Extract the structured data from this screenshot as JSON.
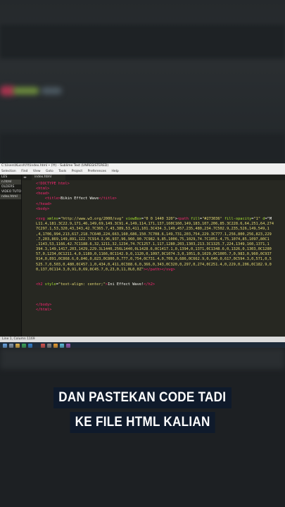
{
  "window": {
    "title": "C:\\Users\\Kucsh\\Yt\\index.html • (Yt) - Sublime Text (UNREGISTERED)",
    "menu": [
      "Selection",
      "Find",
      "View",
      "Goto",
      "Tools",
      "Project",
      "Preferences",
      "Help"
    ],
    "sidebar_items": [
      "LES",
      "n.html",
      "OLDERS",
      "VIDEO TUTORI",
      "ndex.html"
    ],
    "tab_label": "index.html",
    "status": "Line 1, Column 1169"
  },
  "code_lines": [
    {
      "parts": [
        [
          "t",
          "<!DOCTYPE html>"
        ]
      ]
    },
    {
      "parts": [
        [
          "t",
          "<html>"
        ]
      ]
    },
    {
      "parts": [
        [
          "t",
          "<head>"
        ]
      ]
    },
    {
      "parts": [
        [
          "d",
          "    "
        ],
        [
          "t",
          "<title>"
        ],
        [
          "d",
          "Bikin Effect Wave"
        ],
        [
          "t",
          "</title>"
        ]
      ]
    },
    {
      "parts": [
        [
          "t",
          "</head>"
        ]
      ]
    },
    {
      "parts": [
        [
          "t",
          "<body>"
        ]
      ]
    },
    {
      "parts": [
        [
          "d",
          ""
        ]
      ]
    },
    {
      "parts": [
        [
          "t",
          "<svg "
        ],
        [
          "a",
          "xmlns"
        ],
        [
          "d",
          "="
        ],
        [
          "s",
          "\"http://www.w3.org/2000/svg\""
        ],
        [
          "a",
          " viewBox"
        ],
        [
          "d",
          "="
        ],
        [
          "s",
          "\"0 0 1440 320\""
        ],
        [
          "d",
          ">"
        ],
        [
          "t",
          "<path "
        ],
        [
          "a",
          "fill"
        ],
        [
          "d",
          "="
        ],
        [
          "s",
          "\"#273036\""
        ],
        [
          "a",
          " fill-opacity"
        ],
        [
          "d",
          "="
        ],
        [
          "s",
          "\"1\""
        ],
        [
          "a",
          " d"
        ],
        [
          "d",
          "=\"M"
        ]
      ]
    },
    {
      "parts": [
        [
          "s",
          "L11.4,181.3C22.9,171,46,149,69,149.3C91.4,149,114,171,137,160C160,149,183,107,206,85.3C228.6,64,251,64,274"
        ]
      ]
    },
    {
      "parts": [
        [
          "s",
          "7C297.1,53,320,43,343,42.7C365.7,43,389,53,411,101.3C434.3,149,457,235,480,234.7C502.9,235,526,149,549,1"
        ]
      ]
    },
    {
      "parts": [
        [
          "s",
          ",4,1706,994,213,617,218.7C640,224,663,160,686,150.7C708.6,149,731,203,754,229.3C777.1,256,800,256,823,229"
        ]
      ]
    },
    {
      "parts": [
        [
          "s",
          ".7,203,869,149,891,122.7C914.3,96,937,96,960,90.7C982.9,85,1006,75,1029,74.7C1051.4,75,1074,85,1097,80C1"
        ]
      ]
    },
    {
      "parts": [
        [
          "s",
          ",1143,53,1166,42.7C1188.6,32,1211,32,1234,74.7C1257.1,117,1280,203,1303,213.3C1325.7,224,1349,160,1371,1"
        ]
      ]
    },
    {
      "parts": [
        [
          "s",
          "394.3,149,1417,203,1429,229.3L1440,256L1440,0L1428.6,0C1417.1,0,1394,0,1371,0C1348.6,0,1326,0,1303,0C1280"
        ]
      ]
    },
    {
      "parts": [
        [
          "s",
          "57,0,1234,0C1211.4,0,1189,0,1166,0C1142.9,0,1120,0,1097,0C1074.3,0,1051,0,1029,0C1005.7,0,983,0,960,0C937"
        ]
      ]
    },
    {
      "parts": [
        [
          "s",
          "914,0,891,0C868.6,0,846,0,823,0C800,0,777,0,754,0C731.4,0,709,0,686,0C662.9,0,640,0,617,0C594.3,0,571,0,5"
        ]
      ]
    },
    {
      "parts": [
        [
          "s",
          "525.7,0,503,0,480,0C457.1,0,434,0,411,0C388.6,0,366,0,343,0C320,0,297,0,274,0C251.4,0,229,0,206,0C182.9,0"
        ]
      ]
    },
    {
      "parts": [
        [
          "s",
          "0,137,0C114.3,0,91,0,69,0C45.7,0,23,0,11,0L0,0Z\""
        ],
        [
          "t",
          "></path></svg>"
        ]
      ]
    },
    {
      "parts": [
        [
          "d",
          ""
        ]
      ]
    },
    {
      "parts": [
        [
          "d",
          ""
        ]
      ]
    },
    {
      "parts": [
        [
          "t",
          "<h2 "
        ],
        [
          "a",
          "style"
        ],
        [
          "d",
          "="
        ],
        [
          "s",
          "\"text-align: center;\""
        ],
        [
          "t",
          ">"
        ],
        [
          "d",
          "Ini Effect Wave!"
        ],
        [
          "t",
          "</h2>"
        ]
      ]
    },
    {
      "parts": [
        [
          "d",
          ""
        ]
      ]
    },
    {
      "parts": [
        [
          "d",
          ""
        ]
      ]
    },
    {
      "parts": [
        [
          "d",
          ""
        ]
      ]
    },
    {
      "parts": [
        [
          "t",
          "</body>"
        ]
      ]
    },
    {
      "parts": [
        [
          "t",
          "</html>"
        ]
      ]
    }
  ],
  "caption": {
    "line1": "DAN PASTEKAN CODE TADI",
    "line2": "KE FILE HTML KALIAN"
  },
  "colors": {
    "editor_bg": "#272822",
    "caption_bg": "#0f1a2b",
    "tag": "#f92672",
    "attr": "#a6e22e",
    "string": "#e6db74"
  }
}
